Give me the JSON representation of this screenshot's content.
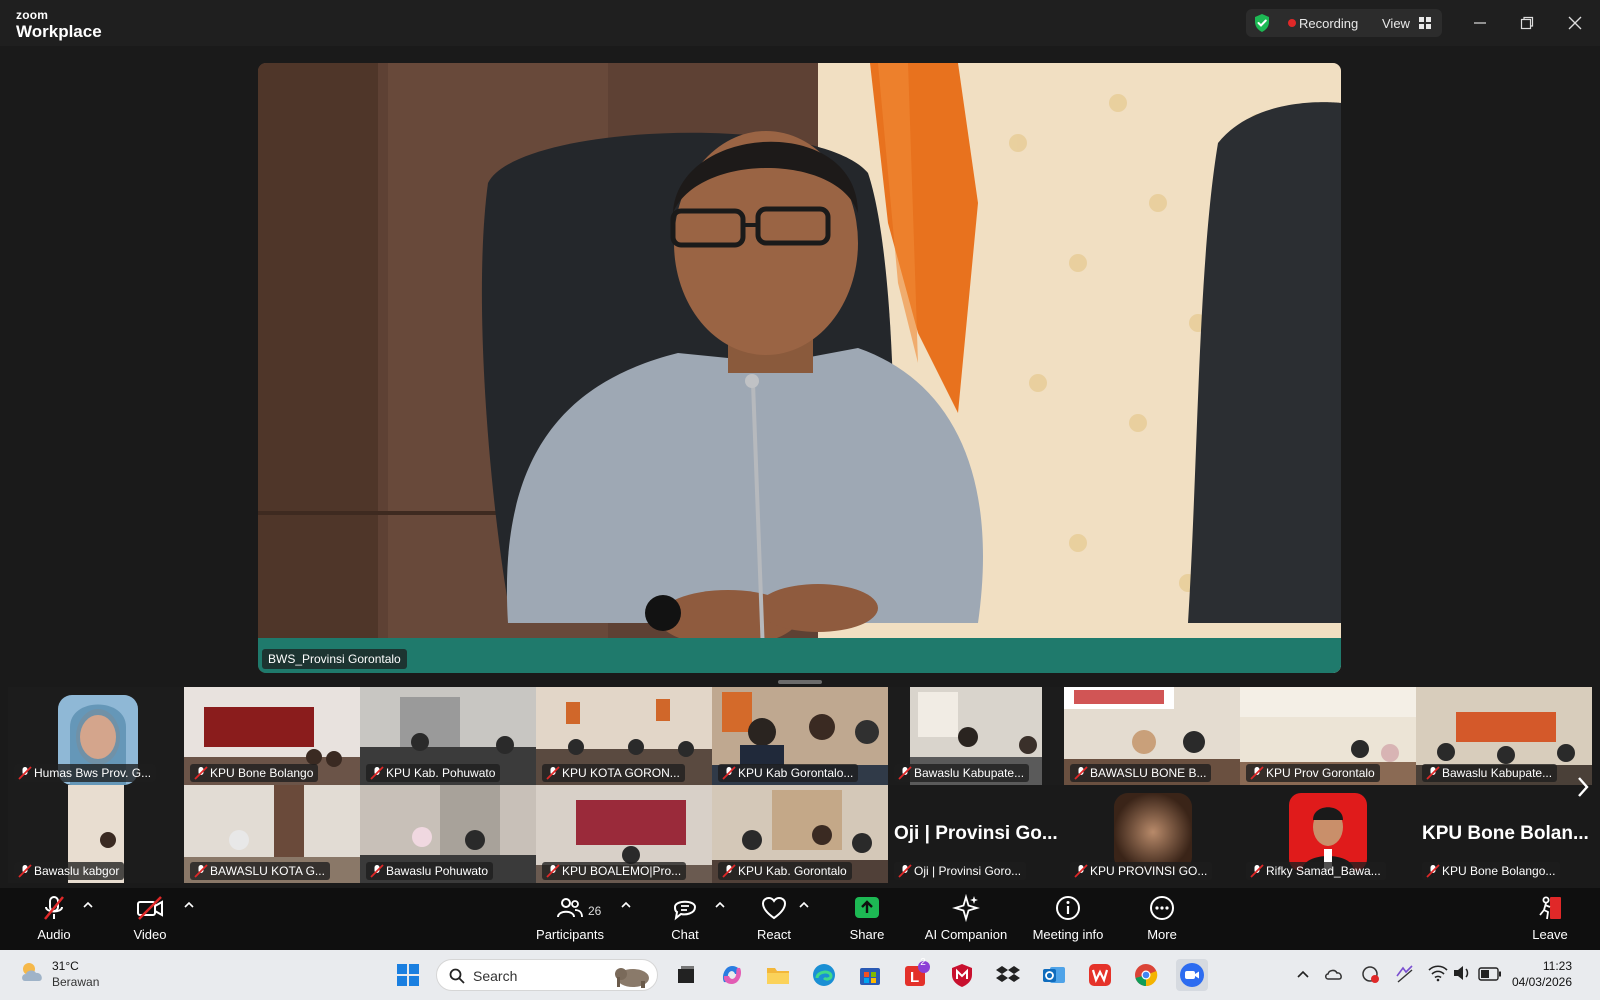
{
  "app": {
    "brand_small": "zoom",
    "brand_big": "Workplace"
  },
  "titlebar": {
    "recording_label": "Recording",
    "view_label": "View"
  },
  "speaker": {
    "name": "BWS_Provinsi Gorontalo"
  },
  "gallery": {
    "row1": [
      {
        "name": "Humas Bws Prov. G..."
      },
      {
        "name": "KPU Bone Bolango"
      },
      {
        "name": "KPU Kab. Pohuwato"
      },
      {
        "name": "KPU KOTA GORON..."
      },
      {
        "name": "KPU Kab Gorontalo..."
      },
      {
        "name": "Bawaslu Kabupate..."
      },
      {
        "name": "BAWASLU BONE B..."
      },
      {
        "name": "KPU Prov Gorontalo"
      },
      {
        "name": "Bawaslu Kabupate..."
      }
    ],
    "row2": [
      {
        "name": "Bawaslu kabgor"
      },
      {
        "name": "BAWASLU KOTA G..."
      },
      {
        "name": "Bawaslu Pohuwato"
      },
      {
        "name": "KPU BOALEMO|Pro..."
      },
      {
        "name": "KPU Kab. Gorontalo"
      },
      {
        "name": "Oji | Provinsi Goro...",
        "big": "Oji | Provinsi Go..."
      },
      {
        "name": "KPU PROVINSI GO..."
      },
      {
        "name": "Rifky Samad_Bawa..."
      },
      {
        "name": "KPU Bone Bolango...",
        "big": "KPU Bone Bolan..."
      }
    ]
  },
  "toolbar": {
    "audio": "Audio",
    "video": "Video",
    "participants": "Participants",
    "participants_count": "26",
    "chat": "Chat",
    "react": "React",
    "share": "Share",
    "ai_companion": "AI Companion",
    "meeting_info": "Meeting info",
    "more": "More",
    "leave": "Leave"
  },
  "taskbar": {
    "temperature": "31°C",
    "condition": "Berawan",
    "search_placeholder": "Search",
    "notification_badge": "2",
    "time": "11:23",
    "date": "04/03/2026"
  },
  "colors": {
    "accent_green": "#1db954",
    "record_red": "#e02828",
    "leave_red": "#e02828",
    "toolbar_bg": "#0f0f0f"
  }
}
